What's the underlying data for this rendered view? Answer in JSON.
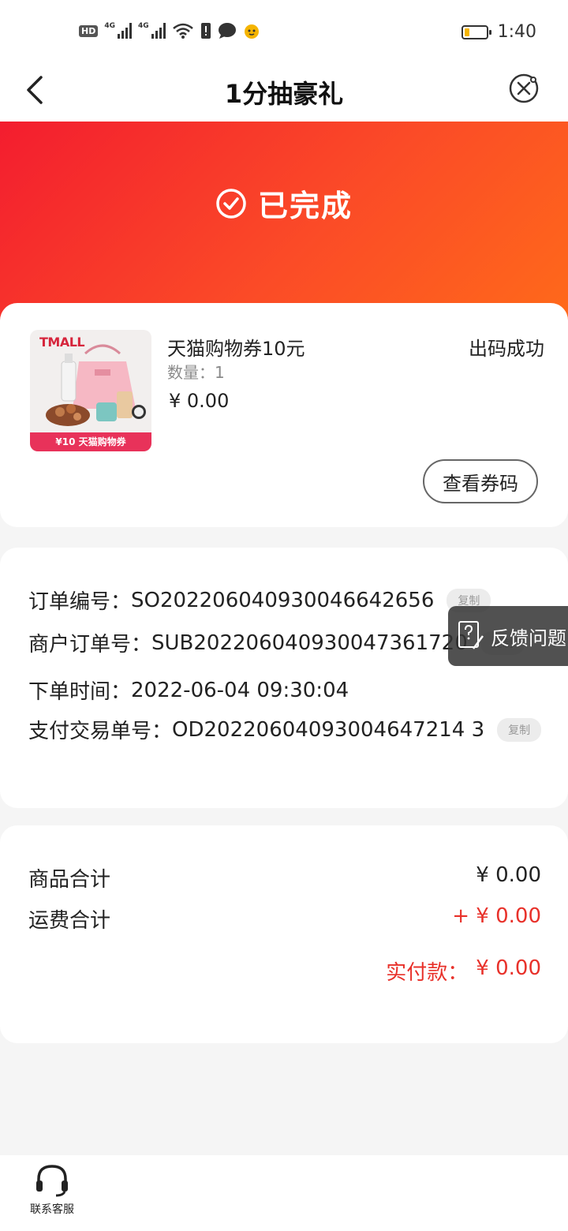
{
  "status_bar": {
    "hd": "HD",
    "network_1": "4G",
    "network_2": "4G",
    "time": "1:40"
  },
  "nav": {
    "title": "1分抽豪礼"
  },
  "banner": {
    "status": "已完成"
  },
  "product": {
    "brand": "TMALL",
    "coupon_strip": "¥10 天猫购物券",
    "name": "天猫购物券10元",
    "qty_label": "数量：",
    "qty_value": "1",
    "price": "¥ 0.00",
    "status": "出码成功",
    "view_code_button": "查看券码"
  },
  "order_info": {
    "order_no_label": "订单编号：",
    "order_no": "SO20220604093004664265‌6",
    "merchant_no_label": "商户订单号：",
    "merchant_no": "SUB202206040930047361720",
    "time_label": "下单时间：",
    "time": "2022-06-04 09:30:04",
    "pay_no_label": "支付交易单号：",
    "pay_no": "OD20220604093004647214 3",
    "copy_label": "复制"
  },
  "totals": {
    "goods_label": "商品合计",
    "goods_value": "¥ 0.00",
    "shipping_label": "运费合计",
    "shipping_value": "+ ¥ 0.00",
    "paid_label": "实付款：",
    "paid_value": "¥ 0.00"
  },
  "floating": {
    "feedback": "反馈问题"
  },
  "bottom": {
    "customer_service": "联系客服"
  },
  "colors": {
    "accent_red": "#e8312a",
    "banner_start": "#f31d2f",
    "banner_end": "#ff6a1a"
  }
}
